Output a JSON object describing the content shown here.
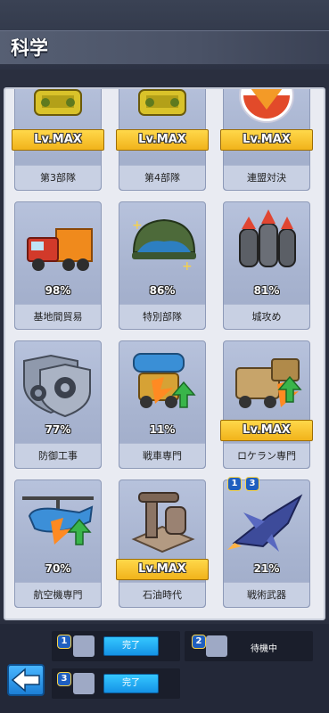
{
  "header": {
    "title": "科学"
  },
  "cards": [
    {
      "name": "第3部隊",
      "status": "Lv.MAX",
      "icon": "tank-icon"
    },
    {
      "name": "第4部隊",
      "status": "Lv.MAX",
      "icon": "tank-icon"
    },
    {
      "name": "連盟対決",
      "status": "Lv.MAX",
      "icon": "shield-emblem-icon"
    },
    {
      "name": "基地間貿易",
      "status": "98%",
      "icon": "truck-icon"
    },
    {
      "name": "特別部隊",
      "status": "86%",
      "icon": "helmet-icon"
    },
    {
      "name": "城攻め",
      "status": "81%",
      "icon": "missiles-icon"
    },
    {
      "name": "防御工事",
      "status": "77%",
      "icon": "gear-shield-icon"
    },
    {
      "name": "戦車専門",
      "status": "11%",
      "icon": "cannon-upgrade-icon"
    },
    {
      "name": "ロケラン専門",
      "status": "Lv.MAX",
      "icon": "rocket-launcher-icon"
    },
    {
      "name": "航空機専門",
      "status": "70%",
      "icon": "helicopter-upgrade-icon"
    },
    {
      "name": "石油時代",
      "status": "Lv.MAX",
      "icon": "oil-pump-icon"
    },
    {
      "name": "戦術武器",
      "status": "21%",
      "icon": "jet-fighter-icon"
    }
  ],
  "card_badges": {
    "tactical": [
      "1",
      "3"
    ]
  },
  "queue": {
    "slot1": {
      "num": "1",
      "button": "完了"
    },
    "slot2": {
      "num": "2",
      "status": "待機中"
    },
    "slot3": {
      "num": "3",
      "button": "完了"
    }
  }
}
